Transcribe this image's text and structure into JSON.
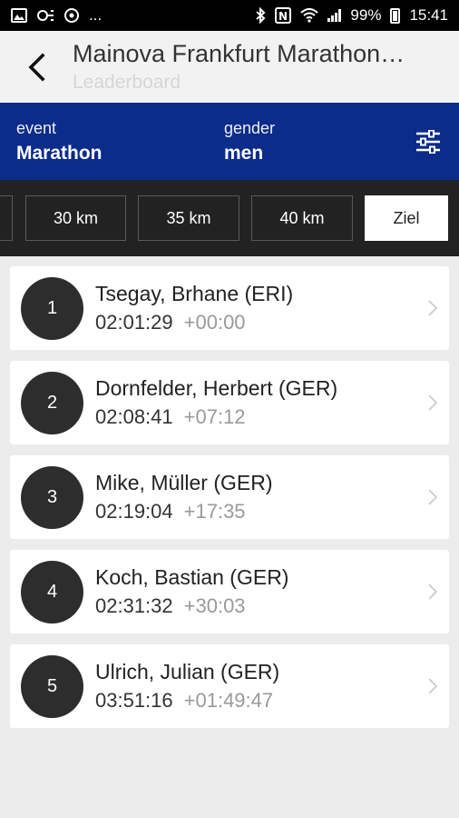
{
  "status_bar": {
    "dots": "...",
    "battery_percent": "99%",
    "time": "15:41",
    "icons_left": [
      "image-icon",
      "cast-icon",
      "sync-icon"
    ],
    "icons_right": [
      "bluetooth-icon",
      "nfc-icon",
      "wifi-icon",
      "signal-icon",
      "battery-icon"
    ]
  },
  "app_bar": {
    "title": "Mainova Frankfurt Marathon…",
    "subtitle": "Leaderboard",
    "back_icon": "arrow-back-icon"
  },
  "filters": {
    "event_label": "event",
    "event_value": "Marathon",
    "gender_label": "gender",
    "gender_value": "men",
    "settings_icon": "sliders-icon",
    "background": "#0c2c8a"
  },
  "split_tabs": {
    "items": [
      "30 km",
      "35 km",
      "40 km",
      "Ziel"
    ],
    "active": "Ziel"
  },
  "leaderboard": [
    {
      "rank": "1",
      "name": "Tsegay, Brhane (ERI)",
      "time": "02:01:29",
      "diff": "+00:00"
    },
    {
      "rank": "2",
      "name": "Dornfelder, Herbert (GER)",
      "time": "02:08:41",
      "diff": "+07:12"
    },
    {
      "rank": "3",
      "name": "Mike, Müller (GER)",
      "time": "02:19:04",
      "diff": "+17:35"
    },
    {
      "rank": "4",
      "name": "Koch, Bastian (GER)",
      "time": "02:31:32",
      "diff": "+30:03"
    },
    {
      "rank": "5",
      "name": "Ulrich, Julian (GER)",
      "time": "03:51:16",
      "diff": "+01:49:47"
    }
  ]
}
